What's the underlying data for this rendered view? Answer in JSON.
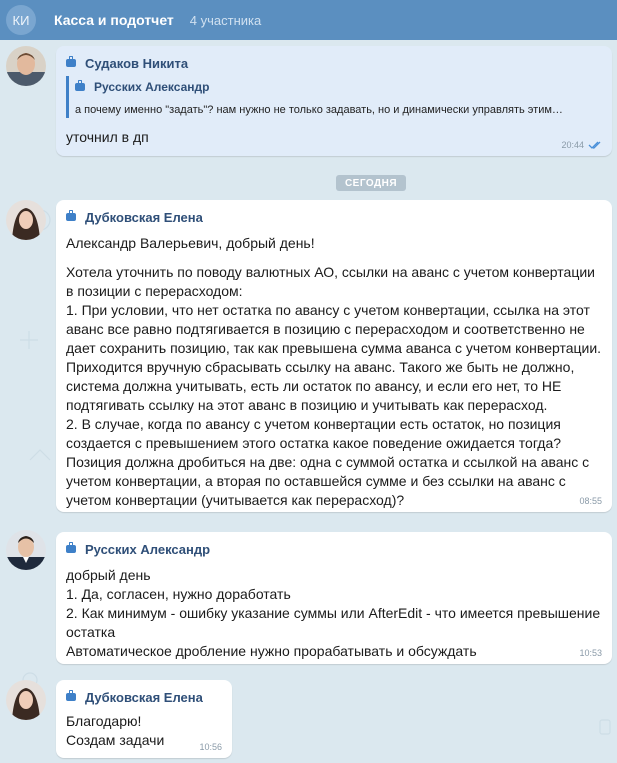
{
  "header": {
    "avatar_initials": "КИ",
    "title": "Касса и подотчет",
    "subtitle": "4 участника"
  },
  "date_separator": "СЕГОДНЯ",
  "messages": [
    {
      "sender": "Судаков Никита",
      "reply": {
        "sender": "Русских Александр",
        "text": "а почему именно \"задать\"? нам нужно не только задавать, но и динамически управлять этим…"
      },
      "paragraphs": [
        "уточнил в дп"
      ],
      "time": "20:44",
      "read": true
    },
    {
      "sender": "Дубковская Елена",
      "paragraphs": [
        "Александр Валерьевич, добрый день!",
        "",
        "Хотела уточнить по поводу валютных АО, ссылки на аванс с учетом конвертации",
        "в позиции с перерасходом:",
        "1. При условии, что нет остатка по авансу с учетом конвертации, ссылка на этот",
        "аванс все равно подтягивается в позицию с перерасходом и соответственно не",
        "дает сохранить позицию, так как превышена сумма аванса с учетом конвертации.",
        "Приходится вручную сбрасывать ссылку на аванс. Такого же быть не должно,",
        "система должна учитывать, есть ли остаток по авансу, и если его нет, то НЕ",
        "подтягивать ссылку на этот аванс в позицию и учитывать как перерасход.",
        "2. В случае, когда по авансу с учетом конвертации есть остаток, но позиция",
        "создается с превышением этого остатка какое поведение ожидается тогда?",
        "Позиция должна дробиться на две: одна с суммой остатка и ссылкой на аванс с",
        "учетом конвертации, а вторая по оставшейся сумме и без ссылки на аванс с",
        "учетом конвертации (учитывается как перерасход)?"
      ],
      "time": "08:55"
    },
    {
      "sender": "Русских Александр",
      "paragraphs": [
        "добрый день",
        "1. Да, согласен, нужно доработать",
        "2. Как минимум - ошибку указание суммы или AfterEdit - что имеется превышение",
        "остатка",
        "Автоматическое дробление нужно прорабатывать и обсуждать"
      ],
      "time": "10:53"
    },
    {
      "sender": "Дубковская Елена",
      "paragraphs": [
        "Благодарю!",
        "Создам задачи"
      ],
      "time": "10:56"
    }
  ],
  "colors": {
    "header": "#5b8fc0",
    "background": "#dbe8ef",
    "own_bubble": "#e1ecf9",
    "accent": "#3e80c8"
  },
  "icons": [
    "briefcase-icon",
    "double-check-icon"
  ]
}
